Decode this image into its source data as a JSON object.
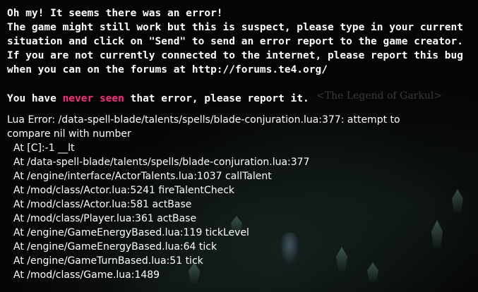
{
  "background": {
    "ghost_text": "<The Legend of Garkul>"
  },
  "error": {
    "header_lines": [
      "Oh my! It seems there was an error!",
      "The game might still work but this is suspect, please type in your current",
      "situation and click on \"Send\" to send an error report to the game creator.",
      "If you are not currently connected to the internet, please report this bug",
      "when you can on the forums at http://forums.te4.org/"
    ],
    "status": {
      "prefix": "You have ",
      "highlight": "never seen",
      "suffix": " that error, please report it."
    },
    "lua_error_lines": [
      "Lua Error: /data-spell-blade/talents/spells/blade-conjuration.lua:377: attempt to",
      "compare nil with number"
    ],
    "stack_trace": [
      "At [C]:-1 __lt",
      "At /data-spell-blade/talents/spells/blade-conjuration.lua:377",
      "At /engine/interface/ActorTalents.lua:1037 callTalent",
      "At /mod/class/Actor.lua:5241 fireTalentCheck",
      "At /mod/class/Actor.lua:581 actBase",
      "At /mod/class/Player.lua:361 actBase",
      "At /engine/GameEnergyBased.lua:119 tickLevel",
      "At /engine/GameEnergyBased.lua:64 tick",
      "At /engine/GameTurnBased.lua:51 tick",
      "At /mod/class/Game.lua:1489"
    ]
  },
  "colors": {
    "text": "#ffffff",
    "highlight": "#ff2a7f",
    "background": "#050505"
  }
}
